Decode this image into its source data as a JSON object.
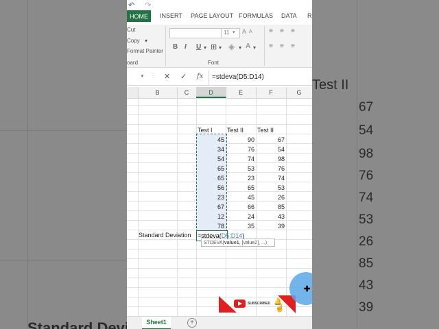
{
  "ribbon": {
    "tabs": [
      "HOME",
      "INSERT",
      "PAGE LAYOUT",
      "FORMULAS",
      "DATA",
      "R"
    ],
    "clipboard": {
      "cut": "Cut",
      "copy": "Copy",
      "format_painter": "Format Painter",
      "group": "oard"
    },
    "font": {
      "size": "11",
      "group": "Font",
      "bold": "B",
      "italic": "I",
      "underline": "U"
    }
  },
  "formula_bar": {
    "content": "=stdeva(D5:D14)",
    "fx": "fx",
    "cancel": "✕",
    "enter": "✓"
  },
  "columns": [
    "B",
    "C",
    "D",
    "E",
    "F",
    "G"
  ],
  "table": {
    "headers": [
      "Test I",
      "Test II",
      "Test II"
    ],
    "rows": [
      [
        "45",
        "90",
        "67"
      ],
      [
        "34",
        "76",
        "54"
      ],
      [
        "54",
        "74",
        "98"
      ],
      [
        "65",
        "53",
        "76"
      ],
      [
        "65",
        "23",
        "74"
      ],
      [
        "56",
        "65",
        "53"
      ],
      [
        "23",
        "45",
        "26"
      ],
      [
        "67",
        "66",
        "85"
      ],
      [
        "12",
        "24",
        "43"
      ],
      [
        "78",
        "35",
        "39"
      ]
    ]
  },
  "std_label": "Standard Deviation",
  "edit_prefix": "=stdeva(",
  "edit_range": "D5:D14",
  "edit_suffix": ")",
  "tooltip": {
    "fn": "STDEVA(",
    "arg1": "value1",
    "rest": ", [value2], ...)"
  },
  "sheet_tab": "Sheet1",
  "add_sheet": "+",
  "overlay": {
    "subscribed": "SUBSCRIBED"
  },
  "background": {
    "right_header": "Test II",
    "right_values": [
      "67",
      "54",
      "98",
      "76",
      "74",
      "53",
      "26",
      "85",
      "43",
      "39"
    ],
    "left_text": "Standard Deviatio"
  },
  "colors": {
    "accent": "#217346",
    "selection_fill": "#e3ecf7",
    "range_text": "#4f81bd"
  }
}
